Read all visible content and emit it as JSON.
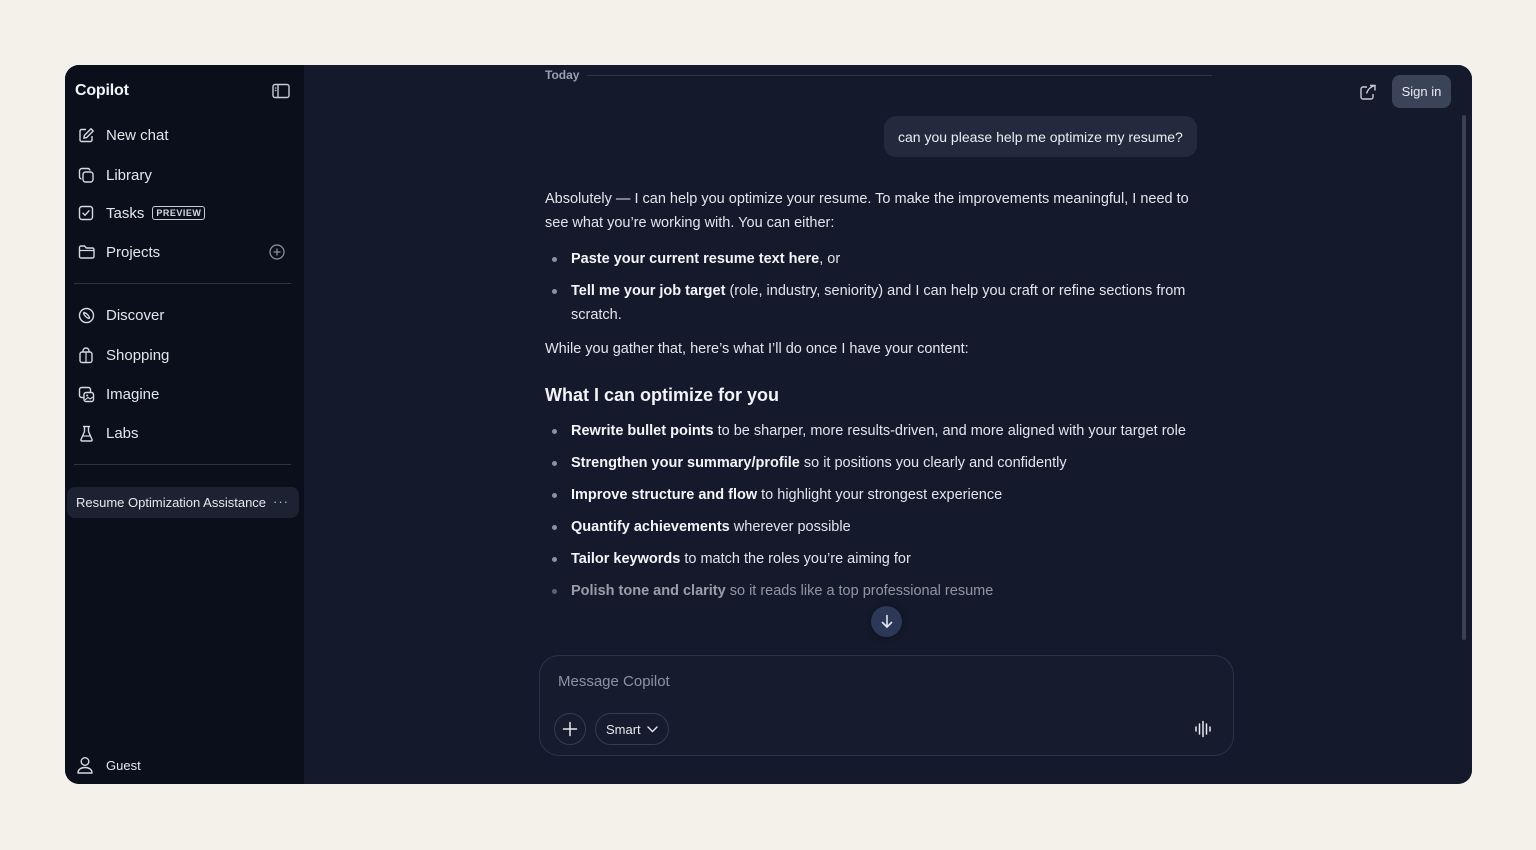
{
  "sidebar": {
    "brand": "Copilot",
    "items": [
      {
        "label": "New chat",
        "icon": "edit-icon"
      },
      {
        "label": "Library",
        "icon": "library-icon"
      },
      {
        "label": "Tasks",
        "icon": "checkbox-icon",
        "badge": "PREVIEW"
      },
      {
        "label": "Projects",
        "icon": "folder-icon"
      },
      {
        "label": "Discover",
        "icon": "compass-icon"
      },
      {
        "label": "Shopping",
        "icon": "shopping-bag-icon"
      },
      {
        "label": "Imagine",
        "icon": "image-icon"
      },
      {
        "label": "Labs",
        "icon": "flask-icon"
      }
    ],
    "recent_chat": "Resume Optimization Assistance",
    "recent_chat_more": "···",
    "user": "Guest"
  },
  "header": {
    "sign_in": "Sign in"
  },
  "conversation": {
    "date_label": "Today",
    "user_message": "can you please help me optimize my resume?",
    "intro": "Absolutely — I can help you optimize your resume. To make the improvements meaningful, I need to see what you’re working with. You can either:",
    "options": [
      {
        "bold": "Paste your current resume text here",
        "rest": ", or"
      },
      {
        "bold": "Tell me your job target",
        "rest": " (role, industry, seniority) and I can help you craft or refine sections from scratch."
      }
    ],
    "transition": "While you gather that, here’s what I’ll do once I have your content:",
    "heading": "What I can optimize for you",
    "optimizations": [
      {
        "bold": "Rewrite bullet points",
        "rest": " to be sharper, more results-driven, and more aligned with your target role"
      },
      {
        "bold": "Strengthen your summary/profile",
        "rest": " so it positions you clearly and confidently"
      },
      {
        "bold": "Improve structure and flow",
        "rest": " to highlight your strongest experience"
      },
      {
        "bold": "Quantify achievements",
        "rest": " wherever possible"
      },
      {
        "bold": "Tailor keywords",
        "rest": " to match the roles you’re aiming for"
      },
      {
        "bold": "Polish tone and clarity",
        "rest": " so it reads like a top professional resume"
      }
    ]
  },
  "composer": {
    "placeholder": "Message Copilot",
    "mode": "Smart"
  },
  "colors": {
    "background": "#141a2b",
    "sidebar": "#0b0f1c",
    "outer": "#f4f1eb"
  }
}
